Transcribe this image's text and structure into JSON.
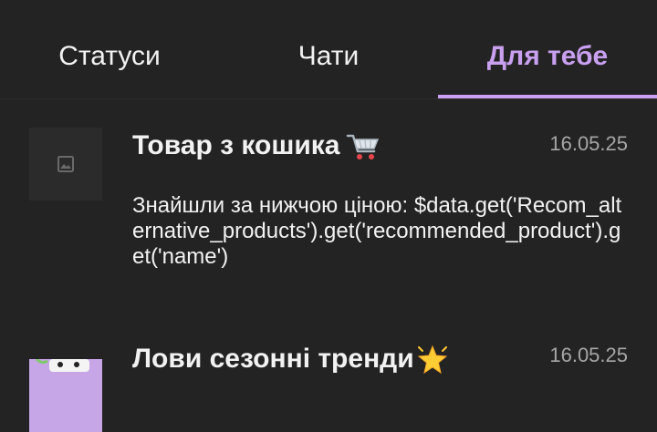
{
  "tabs": [
    {
      "label": "Статуси",
      "active": false
    },
    {
      "label": "Чати",
      "active": false
    },
    {
      "label": "Для тебе",
      "active": true
    }
  ],
  "colors": {
    "background": "#232323",
    "accent": "#c9a0f0",
    "text": "#f2f2f2",
    "muted": "#a6a6a6",
    "thumb_placeholder": "#2b2b2b"
  },
  "feed": [
    {
      "title": "Товар з кошика",
      "title_emoji": "shopping-cart-icon",
      "date": "16.05.25",
      "body": "Знайшли за нижчою ціною: $data.get('Recom_alternative_products').get('recommended_product').get('name')",
      "thumbnail": "image-placeholder-icon"
    },
    {
      "title": "Лови сезонні тренди",
      "title_emoji": "glowing-star-icon",
      "date": "16.05.25",
      "thumbnail": "promo-image"
    }
  ]
}
